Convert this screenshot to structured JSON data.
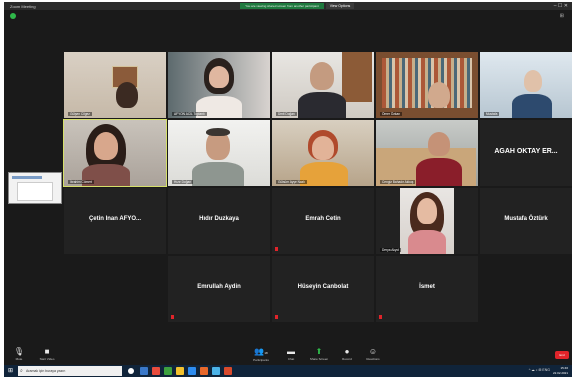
{
  "window": {
    "title": "Zoom Meeting",
    "banner": "You are viewing shared screen from another participant",
    "view_button": "View Options",
    "controls": "– ☐ ✕"
  },
  "participants": [
    {
      "name": "Gülşen Cilgez",
      "type": "video"
    },
    {
      "name": "AFYON ACİL Toplantı",
      "type": "video"
    },
    {
      "name": "Ümit Doğan",
      "type": "video"
    },
    {
      "name": "Ömer Özkan",
      "type": "video"
    },
    {
      "name": "Mustafa",
      "type": "video"
    },
    {
      "name": "İbrahim Cömert",
      "type": "video",
      "active": true
    },
    {
      "name": "Hızır Doğan",
      "type": "video"
    },
    {
      "name": "Gülsüm Ayşe Nazlı",
      "type": "video"
    },
    {
      "name": "Cengiz Bahadır Akkuş",
      "type": "video"
    },
    {
      "name": "AGAH OKTAY ER...",
      "type": "name"
    },
    {
      "name": "Çetin Inan AFYO...",
      "type": "name"
    },
    {
      "name": "Hıdır Duzkaya",
      "type": "name"
    },
    {
      "name": "Emrah Cetin",
      "type": "name"
    },
    {
      "name": "Derya Akyol",
      "type": "video"
    },
    {
      "name": "Mustafa Öztürk",
      "type": "name"
    },
    {
      "name": "Emrullah Aydin",
      "type": "name"
    },
    {
      "name": "Hüseyin Canbolat",
      "type": "name"
    },
    {
      "name": "İsmet",
      "type": "name"
    }
  ],
  "toolbar": {
    "unmute": "Mute",
    "start_video": "Start Video",
    "participants": "Participants",
    "participants_count": "18",
    "chat": "Chat",
    "share": "Share Screen",
    "record": "Record",
    "reactions": "Reactions",
    "end": "End"
  },
  "taskbar": {
    "search_placeholder": "Aramak için buraya yazın",
    "tray": "^ ☁ ♪ ⊞ ENG",
    "time": "15:46",
    "date": "22.02.2021"
  }
}
